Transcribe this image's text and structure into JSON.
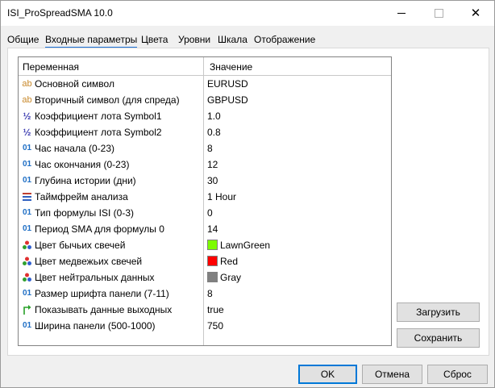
{
  "window": {
    "title": "ISI_ProSpreadSMA 10.0"
  },
  "tabs": [
    {
      "label": "Общие"
    },
    {
      "label": "Входные параметры"
    },
    {
      "label": "Цвета"
    },
    {
      "label": "Уровни"
    },
    {
      "label": "Шкала"
    },
    {
      "label": "Отображение"
    }
  ],
  "grid": {
    "header": {
      "variable": "Переменная",
      "value": "Значение"
    },
    "rows": [
      {
        "icon": "ab",
        "name": "Основной символ",
        "value": "EURUSD"
      },
      {
        "icon": "ab",
        "name": "Вторичный символ (для спреда)",
        "value": "GBPUSD"
      },
      {
        "icon": "½",
        "name": "Коэффициент лота Symbol1",
        "value": "1.0"
      },
      {
        "icon": "½",
        "name": "Коэффициент лота Symbol2",
        "value": "0.8"
      },
      {
        "icon": "01",
        "name": "Час начала (0-23)",
        "value": "8"
      },
      {
        "icon": "01",
        "name": "Час окончания (0-23)",
        "value": "12"
      },
      {
        "icon": "01",
        "name": "Глубина истории (дни)",
        "value": "30"
      },
      {
        "icon": "enum",
        "name": "Таймфрейм анализа",
        "value": "1 Hour"
      },
      {
        "icon": "01",
        "name": "Тип формулы ISI (0-3)",
        "value": "0"
      },
      {
        "icon": "01",
        "name": "Период SMA для формулы 0",
        "value": "14"
      },
      {
        "icon": "color",
        "name": "Цвет бычьих свечей",
        "value": "LawnGreen",
        "swatch": "#7cfc00"
      },
      {
        "icon": "color",
        "name": "Цвет медвежьих свечей",
        "value": "Red",
        "swatch": "#ff0000"
      },
      {
        "icon": "color",
        "name": "Цвет нейтральных данных",
        "value": "Gray",
        "swatch": "#808080"
      },
      {
        "icon": "01",
        "name": "Размер шрифта панели (7-11)",
        "value": "8"
      },
      {
        "icon": "bool",
        "name": "Показывать данные выходных",
        "value": "true"
      },
      {
        "icon": "01",
        "name": "Ширина панели (500-1000)",
        "value": "750"
      }
    ]
  },
  "buttons": {
    "load": "Загрузить",
    "save": "Сохранить",
    "ok": "OK",
    "cancel": "Отмена",
    "reset": "Сброс"
  }
}
